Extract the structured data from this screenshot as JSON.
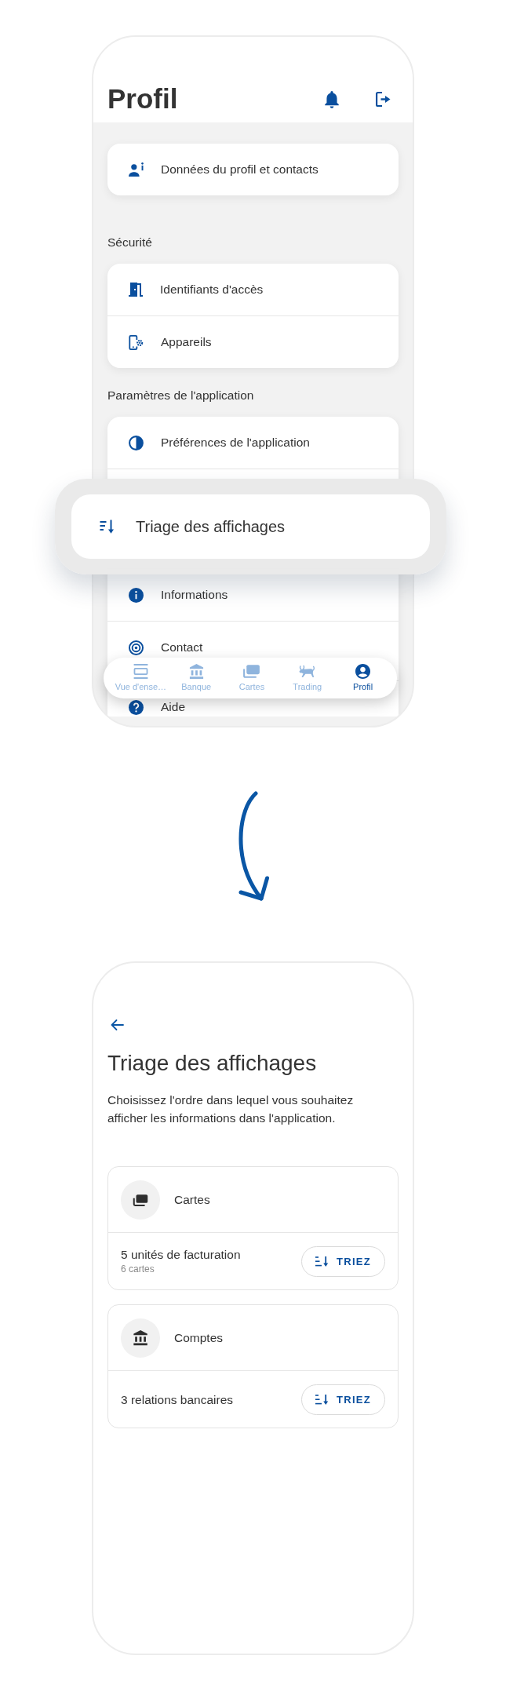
{
  "profile_screen": {
    "title": "Profil",
    "sections": [
      {
        "items": [
          {
            "label": "Données du profil et contacts"
          }
        ]
      },
      {
        "heading": "Sécurité",
        "items": [
          {
            "label": "Identifiants d'accès"
          },
          {
            "label": "Appareils"
          }
        ]
      },
      {
        "heading": "Paramètres de l'application",
        "items": [
          {
            "label": "Préférences de l'application"
          },
          {
            "label": "Informations"
          },
          {
            "label": "Contact"
          },
          {
            "label": "Aide"
          }
        ]
      }
    ],
    "highlighted_item": {
      "label": "Triage des affichages"
    },
    "bottom_nav": [
      {
        "label": "Vue d'ense…",
        "selected": false
      },
      {
        "label": "Banque",
        "selected": false
      },
      {
        "label": "Cartes",
        "selected": false
      },
      {
        "label": "Trading",
        "selected": false
      },
      {
        "label": "Profil",
        "selected": true
      }
    ]
  },
  "sort_screen": {
    "title": "Triage des affichages",
    "description": "Choisissez l'ordre dans lequel vous souhaitez afficher les informations dans l'application.",
    "groups": [
      {
        "title": "Cartes",
        "summary": "5 unités de facturation",
        "detail": "6 cartes",
        "button": "TRIEZ"
      },
      {
        "title": "Comptes",
        "summary": "3 relations bancaires",
        "button": "TRIEZ"
      }
    ]
  }
}
